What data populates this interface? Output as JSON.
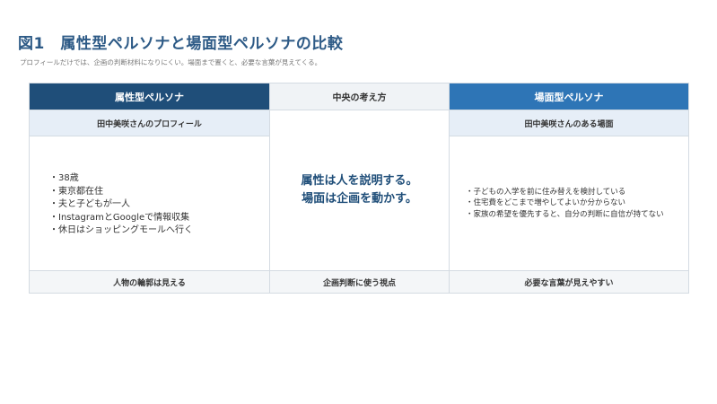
{
  "figure": {
    "title": "図1　属性型ペルソナと場面型ペルソナの比較",
    "subtitle": "プロフィールだけでは、企画の判断材料になりにくい。場面まで置くと、必要な言葉が見えてくる。"
  },
  "table": {
    "headers": {
      "left": "属性型ペルソナ",
      "center": "中央の考え方",
      "right": "場面型ペルソナ"
    },
    "subheaders": {
      "left": "田中美咲さんのプロフィール",
      "right": "田中美咲さんのある場面"
    },
    "left_items": [
      "・38歳",
      "・東京都在住",
      "・夫と子どもが一人",
      "・InstagramとGoogleで情報収集",
      "・休日はショッピングモールへ行く"
    ],
    "center_lines": [
      "属性は人を説明する。",
      "場面は企画を動かす。"
    ],
    "right_items": [
      "・子どもの入学を前に住み替えを検討している",
      "・住宅費をどこまで増やしてよいか分からない",
      "・家族の希望を優先すると、自分の判断に自信が持てない"
    ],
    "footers": {
      "left": "人物の輪郭は見える",
      "center": "企画判断に使う視点",
      "right": "必要な言葉が見えやすい"
    }
  },
  "colors": {
    "title": "#2d5a86",
    "header_left": "#1f4e79",
    "header_right": "#2e75b6",
    "subheader": "#e6eef7",
    "center_text": "#1f4e79"
  }
}
